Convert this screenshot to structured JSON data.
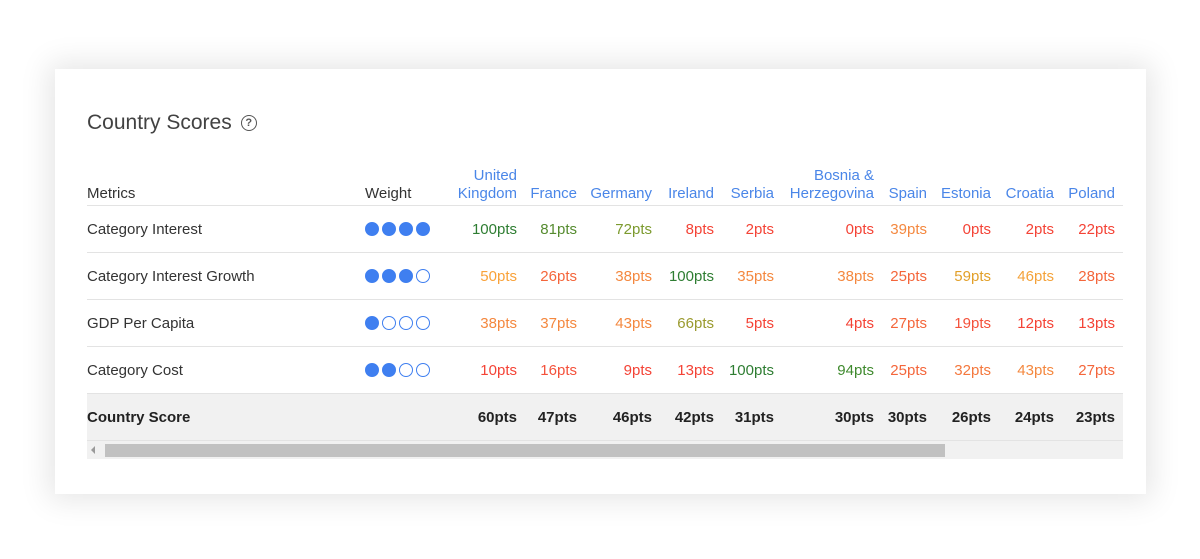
{
  "card": {
    "title": "Country Scores",
    "help_icon": "question-circle-icon"
  },
  "table": {
    "metrics_header": "Metrics",
    "weight_header": "Weight",
    "countries": [
      [
        "United",
        "Kingdom"
      ],
      [
        "",
        "France"
      ],
      [
        "",
        "Germany"
      ],
      [
        "",
        "Ireland"
      ],
      [
        "",
        "Serbia"
      ],
      [
        "Bosnia &",
        "Herzegovina"
      ],
      [
        "",
        "Spain"
      ],
      [
        "",
        "Estonia"
      ],
      [
        "",
        "Croatia"
      ],
      [
        "",
        "Poland"
      ]
    ],
    "rows": [
      {
        "metric": "Category Interest",
        "weight": 4,
        "weight_max": 4,
        "values": [
          "100pts",
          "81pts",
          "72pts",
          "8pts",
          "2pts",
          "0pts",
          "39pts",
          "0pts",
          "2pts",
          "22pts"
        ],
        "colors": [
          "#2e7d32",
          "#558b2f",
          "#7c9a2e",
          "#f44336",
          "#f44336",
          "#f44336",
          "#f4883f",
          "#f44336",
          "#f44336",
          "#f44336"
        ]
      },
      {
        "metric": "Category Interest Growth",
        "weight": 3,
        "weight_max": 4,
        "values": [
          "50pts",
          "26pts",
          "38pts",
          "100pts",
          "35pts",
          "38pts",
          "25pts",
          "59pts",
          "46pts",
          "28pts"
        ],
        "colors": [
          "#f9a23a",
          "#f4663b",
          "#f4883f",
          "#2e7d32",
          "#f4883f",
          "#f4883f",
          "#f4663b",
          "#e2a02a",
          "#f4a23a",
          "#f4663b"
        ]
      },
      {
        "metric": "GDP Per Capita",
        "weight": 1,
        "weight_max": 4,
        "values": [
          "38pts",
          "37pts",
          "43pts",
          "66pts",
          "5pts",
          "4pts",
          "27pts",
          "19pts",
          "12pts",
          "13pts"
        ],
        "colors": [
          "#f4883f",
          "#f4883f",
          "#f4883f",
          "#9a9a2e",
          "#f44336",
          "#f44336",
          "#f4663b",
          "#f4513b",
          "#f44336",
          "#f44336"
        ]
      },
      {
        "metric": "Category Cost",
        "weight": 2,
        "weight_max": 4,
        "values": [
          "10pts",
          "16pts",
          "9pts",
          "13pts",
          "100pts",
          "94pts",
          "25pts",
          "32pts",
          "43pts",
          "27pts"
        ],
        "colors": [
          "#f44336",
          "#f4513b",
          "#f44336",
          "#f44336",
          "#2e7d32",
          "#3f8a2e",
          "#f4663b",
          "#f4783d",
          "#f4883f",
          "#f4663b"
        ]
      }
    ],
    "total": {
      "label": "Country Score",
      "values": [
        "60pts",
        "47pts",
        "46pts",
        "42pts",
        "31pts",
        "30pts",
        "30pts",
        "26pts",
        "24pts",
        "23pts"
      ]
    }
  },
  "scrollbar": {
    "left_arrow_icon": "scroll-left-arrow-icon"
  }
}
